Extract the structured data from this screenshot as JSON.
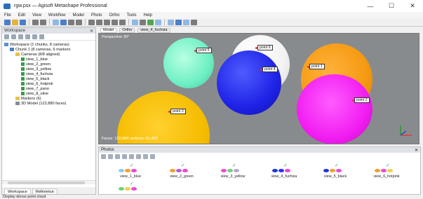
{
  "window": {
    "title": "rgw.psx — Agisoft Metashape Professional",
    "minimize": "—",
    "maximize": "☐",
    "close": "✕"
  },
  "menu": [
    "File",
    "Edit",
    "View",
    "Workflow",
    "Model",
    "Photo",
    "Ortho",
    "Tools",
    "Help"
  ],
  "workspace": {
    "header": "Workspace",
    "header_close": "✕",
    "tree": [
      {
        "label": "Workspace (1 chunks, 8 cameras)",
        "icon": "workspace-icon",
        "indent": 0
      },
      {
        "label": "Chunk 1 (8 cameras, 6 markers",
        "icon": "chunk-icon",
        "indent": 1
      },
      {
        "label": "Cameras (8/8 aligned)",
        "icon": "folder-icon",
        "indent": 2
      },
      {
        "label": "view_1_blue",
        "icon": "camera-icon",
        "indent": 3
      },
      {
        "label": "view_2_green",
        "icon": "camera-icon",
        "indent": 3
      },
      {
        "label": "view_3_yellow",
        "icon": "camera-icon",
        "indent": 3
      },
      {
        "label": "view_4_fuchsia",
        "icon": "camera-icon",
        "indent": 3
      },
      {
        "label": "view_5_black",
        "icon": "camera-icon",
        "indent": 3
      },
      {
        "label": "view_6_hotpink",
        "icon": "camera-icon",
        "indent": 3
      },
      {
        "label": "view_7_pano",
        "icon": "camera-icon",
        "indent": 3
      },
      {
        "label": "view_8_olive",
        "icon": "camera-icon",
        "indent": 3
      },
      {
        "label": "Markers (6)",
        "icon": "folder-icon",
        "indent": 2
      },
      {
        "label": "3D Model (122,880 faces)",
        "icon": "model-icon",
        "indent": 2
      }
    ],
    "tabs": [
      "Workspace",
      "Reference"
    ]
  },
  "view_tabs": [
    "Model",
    "Ortho",
    "view_4_fuchsia"
  ],
  "viewport": {
    "label": "Perspective 30°",
    "status": "Faces: 122,880 vertices: 61,452",
    "points": [
      "point 1",
      "point 2",
      "point 3",
      "point 4",
      "point 5",
      "point 6"
    ]
  },
  "photos": {
    "header": "Photos",
    "header_close": "✕",
    "items": [
      {
        "label": "view_1_blue",
        "dots": [
          "#8ec9e8",
          "#f2a02a",
          "#e94bd0"
        ]
      },
      {
        "label": "view_2_green",
        "dots": [
          "#f2a02a",
          "#b55ad6",
          "#e94bd0"
        ]
      },
      {
        "label": "view_3_yellow",
        "dots": [
          "#e94bd0",
          "#6fd07a",
          "#b8a6d6"
        ]
      },
      {
        "label": "view_4_fuchsia",
        "dots": [
          "#1a3ad0",
          "#2e2ef0",
          "#e94bd0"
        ]
      },
      {
        "label": "view_5_black",
        "dots": [
          "#1a3ad0",
          "#f2a02a",
          "#e94bd0"
        ]
      },
      {
        "label": "view_6_hotpink",
        "dots": [
          "#f2a02a",
          "#e94bd0",
          "#f0d24a"
        ]
      },
      {
        "label": "",
        "dots": [
          "#6fd07a",
          "#f0d24a",
          "#e94bd0"
        ]
      }
    ]
  },
  "status": "Display dense point cloud"
}
